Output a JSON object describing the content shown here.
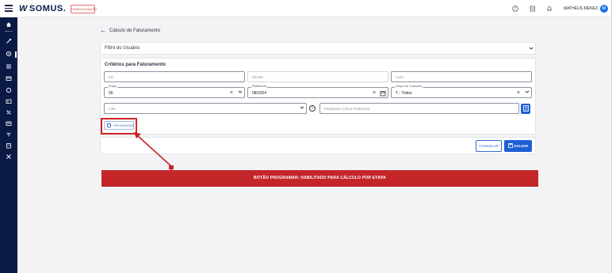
{
  "topbar": {
    "brand": "SOMUS.",
    "brand_mark": "W",
    "env_badge": "HOMOLOGAÇÃO",
    "user_name": "MATHEUS MENEZ...",
    "avatar_initial": "M",
    "help_icon": "?",
    "doc_icon": "doc",
    "bell_icon": "bell"
  },
  "sidebar": {
    "items": [
      "home-icon",
      "tools-icon",
      "gear-icon",
      "list-icon",
      "card-icon",
      "circle-icon",
      "id-card-icon",
      "chart-icon",
      "keyboard-icon",
      "filter-icon",
      "doc-icon",
      "wrench-icon"
    ]
  },
  "page": {
    "back_label": "Cálculo de Faturamento"
  },
  "filter": {
    "title": "Filtro do Usuário"
  },
  "criteria": {
    "title": "Critérios para Faturamento",
    "uc_placeholder": "UC",
    "client_placeholder": "Cliente",
    "book_placeholder": "Livro",
    "stage_label": "Etapa",
    "stage_value": "00",
    "reference_label": "Referência",
    "reference_value": "08/2024",
    "consumption_group_label": "Grupo de Consumo",
    "consumption_group_value": "T - Todos",
    "batch_placeholder": "Lote",
    "critical_param_placeholder": "Parâmetro Crítica Financeira",
    "program_button": "PROGRAMAR"
  },
  "actions": {
    "cancel": "CANCELAR",
    "save": "SALVAR"
  },
  "annotation": {
    "callout_text": "BOTÃO PROGRAMAR: HABILITADO PARA CÁLCULO POR ETAPA",
    "color": "#c4262a"
  }
}
